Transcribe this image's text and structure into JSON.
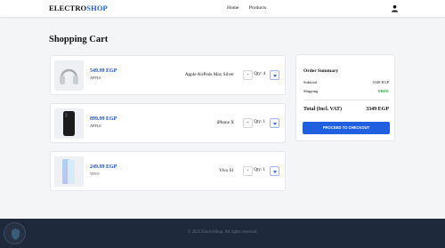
{
  "header": {
    "logo_part1": "ELECTRO",
    "logo_part2": "SHOP",
    "nav": [
      "Home",
      "Products"
    ],
    "user_icon": "user-icon"
  },
  "page": {
    "title": "Shopping Cart"
  },
  "cart": {
    "items": [
      {
        "price": "549.99 EGP",
        "brand": "APPLE",
        "name": "Apple AirPods Max Silver",
        "qty_label": "Qty: 4",
        "minus": "-",
        "thumb": "airpods-max-image"
      },
      {
        "price": "899.99 EGP",
        "brand": "APPLE",
        "name": "iPhone X",
        "qty_label": "Qty: 1",
        "minus": "-",
        "thumb": "iphone-x-image"
      },
      {
        "price": "249.99 EGP",
        "brand": "VIVO",
        "name": "Vivo S1",
        "qty_label": "Qty: 1",
        "minus": "-",
        "thumb": "vivo-s1-image"
      }
    ]
  },
  "summary": {
    "title": "Order Summary",
    "subtotal_label": "Subtotal",
    "subtotal_value": "3349 EGP",
    "shipping_label": "Shipping",
    "shipping_value": "FREE",
    "total_label": "Total (Incl. VAT)",
    "total_value": "3349 EGP",
    "checkout_label": "PROCEED TO CHECKOUT"
  },
  "footer": {
    "copyright": "© 2025 ElectroShop. All rights reserved."
  },
  "colors": {
    "accent": "#1f5fe0",
    "brand_blue": "#1f5fd0",
    "price": "#1f4fbf",
    "free": "#1f9a3a",
    "footer_bg": "#1e293b"
  }
}
